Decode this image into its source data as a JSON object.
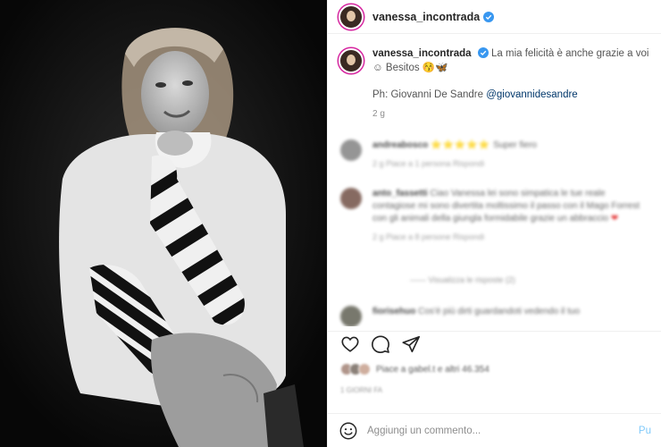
{
  "post": {
    "username": "vanessa_incontrada",
    "verified": true,
    "caption_text": "La mia felicità è anche grazie a voi ☺ Besitos 😚🦋",
    "caption_credit_prefix": "Ph: Giovanni De Sandre ",
    "caption_credit_mention": "@giovannidesandre",
    "caption_time": "2 g"
  },
  "comments": [
    {
      "user": "andreabosco",
      "text": "⭐⭐⭐⭐⭐",
      "text_suffix": " Super fiero",
      "meta": "2 g   Piace a 1 persona   Rispondi"
    },
    {
      "user": "anto_fassetti",
      "text": "Ciao Vanessa lei sono simpatica le tue reale contagiose mi sono divertita moltissimo il passo con il Mago Forrest con gli animali della giungla formidabile grazie un abbraccio",
      "text_suffix": " ❤",
      "meta": "2 g   Piace a 8 persone   Rispondi"
    },
    {
      "user": "fiorisehuo",
      "text": "Cos'è più dirti guardandoti vedendo il tuo",
      "text_suffix": "",
      "meta": ""
    }
  ],
  "replies_link": "——  Visualizza le risposte (2)",
  "likes_text": "Piace a gabel.t e altri 46.354",
  "post_date": "1 GIORNI FA",
  "comment_box": {
    "placeholder": "Aggiungi un commento...",
    "publish_label": "Pu"
  },
  "icons": {
    "verified": "verified-badge-icon",
    "like": "heart-icon",
    "comment": "comment-bubble-icon",
    "share": "paper-plane-icon",
    "emoji": "smiley-icon"
  },
  "colors": {
    "verified_blue": "#3897f0",
    "link_blue": "#00376b",
    "publish_blue": "#0095f6"
  }
}
